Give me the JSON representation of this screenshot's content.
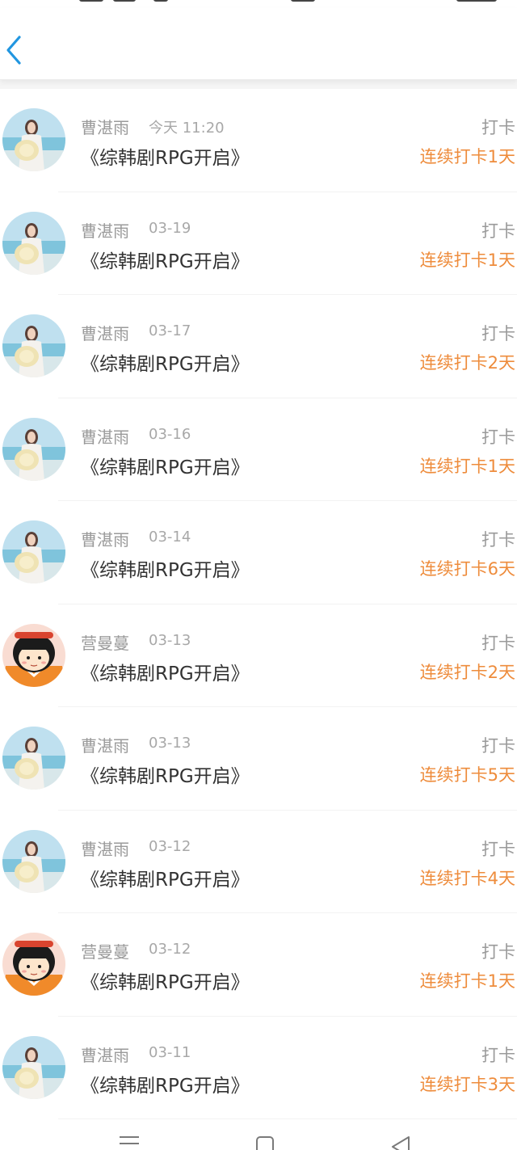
{
  "header": {
    "back_icon": "chevron-left-icon"
  },
  "colors": {
    "accent": "#ee8c3c",
    "back": "#2196e0",
    "muted": "#9a9a9a",
    "text": "#333333"
  },
  "checkins": [
    {
      "user": "曹湛雨",
      "date": "今天 11:20",
      "title": "《综韩剧RPG开启》",
      "type": "打卡",
      "streak": "连续打卡1天",
      "avatar": "girl-beach"
    },
    {
      "user": "曹湛雨",
      "date": "03-19",
      "title": "《综韩剧RPG开启》",
      "type": "打卡",
      "streak": "连续打卡1天",
      "avatar": "girl-beach"
    },
    {
      "user": "曹湛雨",
      "date": "03-17",
      "title": "《综韩剧RPG开启》",
      "type": "打卡",
      "streak": "连续打卡2天",
      "avatar": "girl-beach"
    },
    {
      "user": "曹湛雨",
      "date": "03-16",
      "title": "《综韩剧RPG开启》",
      "type": "打卡",
      "streak": "连续打卡1天",
      "avatar": "girl-beach"
    },
    {
      "user": "曹湛雨",
      "date": "03-14",
      "title": "《综韩剧RPG开启》",
      "type": "打卡",
      "streak": "连续打卡6天",
      "avatar": "girl-beach"
    },
    {
      "user": "营曼蔓",
      "date": "03-13",
      "title": "《综韩剧RPG开启》",
      "type": "打卡",
      "streak": "连续打卡2天",
      "avatar": "cartoon-girl"
    },
    {
      "user": "曹湛雨",
      "date": "03-13",
      "title": "《综韩剧RPG开启》",
      "type": "打卡",
      "streak": "连续打卡5天",
      "avatar": "girl-beach"
    },
    {
      "user": "曹湛雨",
      "date": "03-12",
      "title": "《综韩剧RPG开启》",
      "type": "打卡",
      "streak": "连续打卡4天",
      "avatar": "girl-beach"
    },
    {
      "user": "营曼蔓",
      "date": "03-12",
      "title": "《综韩剧RPG开启》",
      "type": "打卡",
      "streak": "连续打卡1天",
      "avatar": "cartoon-girl"
    },
    {
      "user": "曹湛雨",
      "date": "03-11",
      "title": "《综韩剧RPG开启》",
      "type": "打卡",
      "streak": "连续打卡3天",
      "avatar": "girl-beach"
    }
  ],
  "navbar": {
    "items": [
      "menu-icon",
      "home-square-icon",
      "back-triangle-icon"
    ]
  }
}
